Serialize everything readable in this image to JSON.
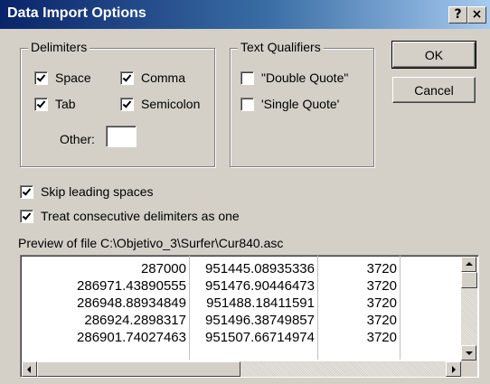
{
  "window": {
    "title": "Data Import Options",
    "help_label": "?",
    "close_label": "×"
  },
  "delimiters": {
    "legend": "Delimiters",
    "space": {
      "label": "Space",
      "checked": true
    },
    "comma": {
      "label": "Comma",
      "checked": true
    },
    "tab": {
      "label": "Tab",
      "checked": true
    },
    "semicolon": {
      "label": "Semicolon",
      "checked": true
    },
    "other_label": "Other:",
    "other_value": ""
  },
  "qualifiers": {
    "legend": "Text Qualifiers",
    "double": {
      "label": "\"Double Quote\"",
      "checked": false
    },
    "single": {
      "label": "'Single Quote'",
      "checked": false
    }
  },
  "buttons": {
    "ok": "OK",
    "cancel": "Cancel"
  },
  "options": {
    "skip_leading": {
      "label": "Skip leading spaces",
      "checked": true
    },
    "consecutive": {
      "label": "Treat consecutive delimiters as one",
      "checked": true
    }
  },
  "preview": {
    "label": "Preview of file C:\\Objetivo_3\\Surfer\\Cur840.asc",
    "rows": [
      [
        "287000",
        "951445.08935336",
        "3720"
      ],
      [
        "286971.43890555",
        "951476.90446473",
        "3720"
      ],
      [
        "286948.88934849",
        "951488.18411591",
        "3720"
      ],
      [
        "286924.2898317",
        "951496.38749857",
        "3720"
      ],
      [
        "286901.74027463",
        "951507.66714974",
        "3720"
      ]
    ]
  }
}
